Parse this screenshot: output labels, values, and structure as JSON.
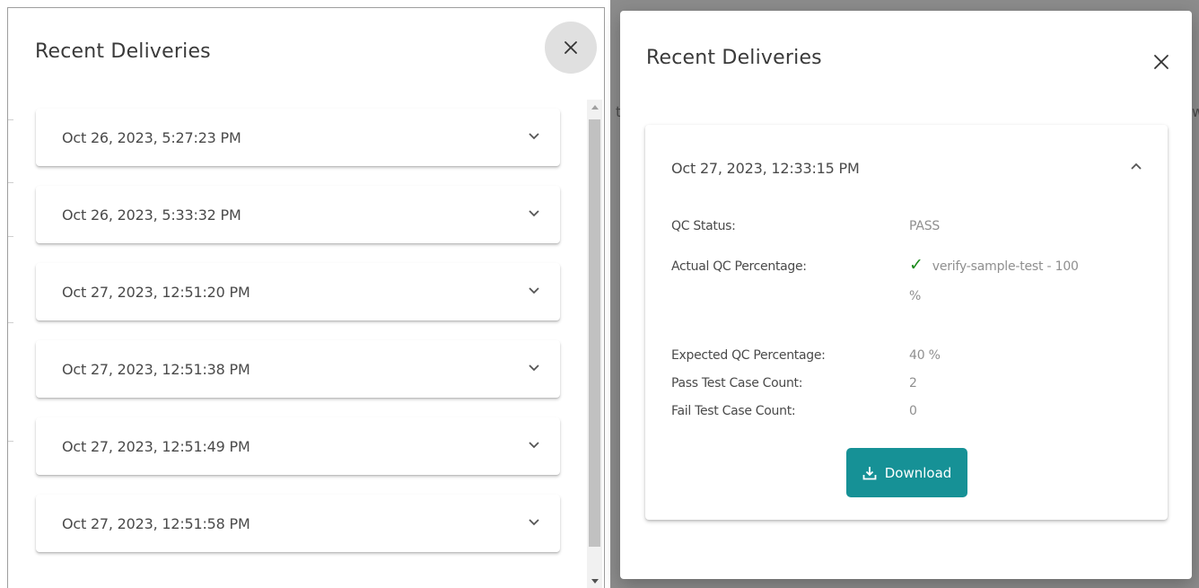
{
  "left_dialog": {
    "title": "Recent Deliveries",
    "items": [
      {
        "date": "Oct 26, 2023, 5:27:23 PM"
      },
      {
        "date": "Oct 26, 2023, 5:33:32 PM"
      },
      {
        "date": "Oct 27, 2023, 12:51:20 PM"
      },
      {
        "date": "Oct 27, 2023, 12:51:38 PM"
      },
      {
        "date": "Oct 27, 2023, 12:51:49 PM"
      },
      {
        "date": "Oct 27, 2023, 12:51:58 PM"
      }
    ]
  },
  "right_dialog": {
    "title": "Recent Deliveries",
    "background_fragments": [
      "t",
      "w"
    ],
    "expanded_item": {
      "date": "Oct 27, 2023, 12:33:15 PM",
      "qc_status_label": "QC Status:",
      "qc_status_value": "PASS",
      "actual_label": "Actual QC Percentage:",
      "actual_value_line1": "verify-sample-test - 100",
      "actual_value_line2": "%",
      "expected_label": "Expected QC Percentage:",
      "expected_value": "40 %",
      "pass_label": "Pass Test Case Count:",
      "pass_value": "2",
      "fail_label": "Fail Test Case Count:",
      "fail_value": "0",
      "download_label": "Download"
    }
  },
  "colors": {
    "accent": "#169196",
    "success": "#1a8a1a",
    "backdrop": "#8c8c8c"
  },
  "icons": [
    "close-icon",
    "chevron-down-icon",
    "chevron-up-icon",
    "check-icon",
    "download-icon",
    "scroll-up-arrow-icon",
    "scroll-down-arrow-icon"
  ]
}
